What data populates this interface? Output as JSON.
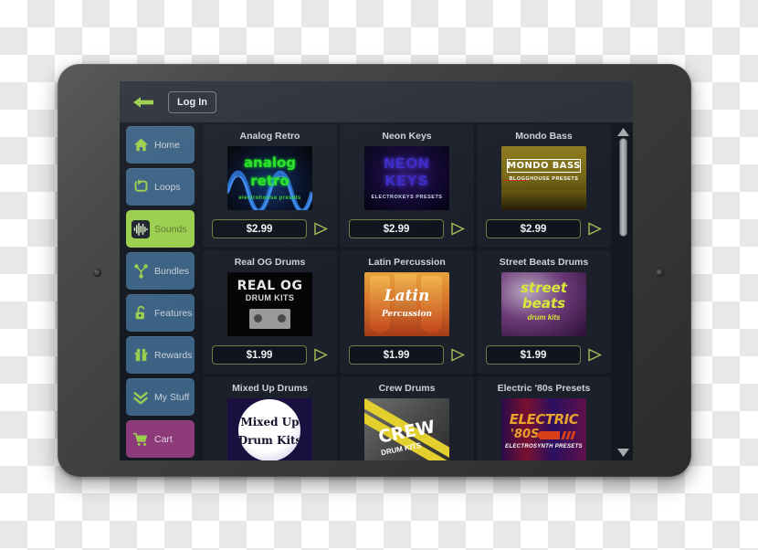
{
  "device": {
    "type": "tablet",
    "frame_color": "#3e3e40"
  },
  "app": {
    "topbar": {
      "back_icon": "arrow-left-icon",
      "login_label": "Log In"
    },
    "sidebar": {
      "items": [
        {
          "label": "Home",
          "icon": "home-icon",
          "state": "normal",
          "color": "#3c6284"
        },
        {
          "label": "Loops",
          "icon": "loop-icon",
          "state": "normal",
          "color": "#3c6284"
        },
        {
          "label": "Sounds",
          "icon": "waveform-icon",
          "state": "active",
          "color": "#9bce4e"
        },
        {
          "label": "Bundles",
          "icon": "share-node-icon",
          "state": "normal",
          "color": "#3c6284"
        },
        {
          "label": "Features",
          "icon": "unlock-icon",
          "state": "normal",
          "color": "#3c6284"
        },
        {
          "label": "Rewards",
          "icon": "gift-icon",
          "state": "normal",
          "color": "#3c6284"
        },
        {
          "label": "My Stuff",
          "icon": "chevrons-down-icon",
          "state": "normal",
          "color": "#3c6284"
        },
        {
          "label": "Cart",
          "icon": "cart-icon",
          "state": "normal",
          "color": "#8c3a79"
        }
      ]
    },
    "products": [
      {
        "title": "Analog Retro",
        "price": "$2.99",
        "art": "tb-analog",
        "art_lines": [
          "analog",
          "retro",
          "electrohouse presets"
        ],
        "play_icon": "play-icon"
      },
      {
        "title": "Neon Keys",
        "price": "$2.99",
        "art": "tb-neon",
        "art_lines": [
          "NEON",
          "KEYS",
          "ELECTROKEYS PRESETS"
        ],
        "play_icon": "play-icon"
      },
      {
        "title": "Mondo Bass",
        "price": "$2.99",
        "art": "tb-mondo",
        "art_lines": [
          "MONDO BASS",
          "BLOGGHOUSE PRESETS"
        ],
        "play_icon": "play-icon"
      },
      {
        "title": "Real OG Drums",
        "price": "$1.99",
        "art": "tb-realog",
        "art_lines": [
          "REAL OG",
          "DRUM KITS"
        ],
        "play_icon": "play-icon"
      },
      {
        "title": "Latin Percussion",
        "price": "$1.99",
        "art": "tb-latin",
        "art_lines": [
          "Latin",
          "Percussion"
        ],
        "play_icon": "play-icon"
      },
      {
        "title": "Street Beats Drums",
        "price": "$1.99",
        "art": "tb-street",
        "art_lines": [
          "street",
          "beats",
          "drum kits"
        ],
        "play_icon": "play-icon"
      },
      {
        "title": "Mixed Up Drums",
        "price": "",
        "art": "tb-mixed",
        "art_lines": [
          "Mixed Up",
          "Drum Kits"
        ],
        "play_icon": "play-icon"
      },
      {
        "title": "Crew Drums",
        "price": "",
        "art": "tb-crew",
        "art_lines": [
          "CREW",
          "DRUM KITS"
        ],
        "play_icon": "play-icon"
      },
      {
        "title": "Electric '80s Presets",
        "price": "",
        "art": "tb-elec",
        "art_lines": [
          "ELECTRIC",
          "'80S",
          "ELECTROSYNTH PRESETS"
        ],
        "play_icon": "play-icon"
      }
    ],
    "scrollbar": {
      "up_icon": "triangle-up-icon",
      "down_icon": "triangle-down-icon",
      "thumb_position_pct": 0,
      "thumb_size_pct": 32
    }
  }
}
